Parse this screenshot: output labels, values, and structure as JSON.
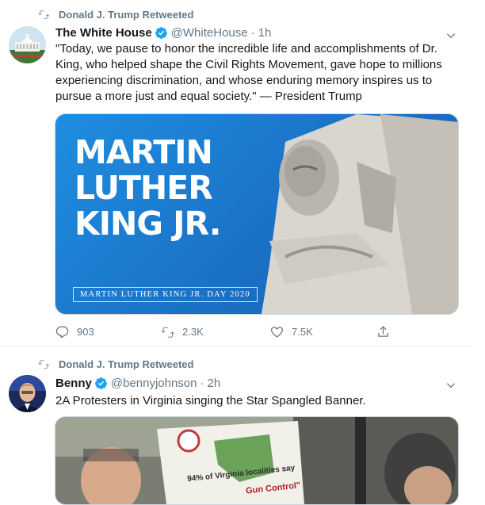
{
  "tweets": [
    {
      "retweet_label": "Donald J. Trump Retweeted",
      "name": "The White House",
      "handle": "@WhiteHouse",
      "time": "1h",
      "text": "\"Today, we pause to honor the incredible life and accomplishments of Dr. King, who helped shape the Civil Rights Movement, gave hope to millions experiencing discrimination, and whose enduring memory inspires us to pursue a more just and equal society.\" — President Trump",
      "media": {
        "title_lines": [
          "MARTIN",
          "LUTHER",
          "KING JR."
        ],
        "footer": "MARTIN LUTHER KING JR. DAY 2020"
      },
      "replies": "903",
      "retweets": "2.3K",
      "likes": "7.5K"
    },
    {
      "retweet_label": "Donald J. Trump Retweeted",
      "name": "Benny",
      "handle": "@bennyjohnson",
      "time": "2h",
      "text": "2A Protesters in Virginia singing the Star Spangled Banner.",
      "media": {
        "sign_text_1": "94% of Virginia localities say",
        "sign_text_2": "Gun Control\""
      }
    }
  ],
  "colors": {
    "accent": "#1da1f2",
    "muted": "#657786",
    "text": "#14171a"
  },
  "icons": [
    "retweet-icon",
    "verified-icon",
    "chevron-down-icon",
    "reply-icon",
    "like-icon",
    "share-icon"
  ]
}
